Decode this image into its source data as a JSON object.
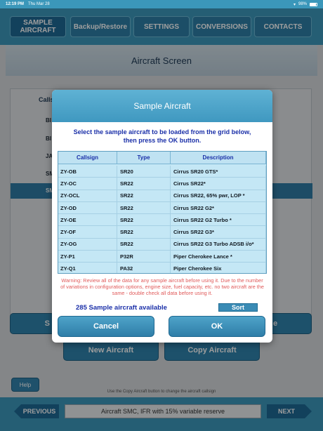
{
  "statusbar": {
    "time": "12:19 PM",
    "date": "Thu Mar 28",
    "battery": "98%"
  },
  "nav": [
    {
      "label": "SAMPLE AIRCRAFT"
    },
    {
      "label": "Backup/Restore"
    },
    {
      "label": "SETTINGS"
    },
    {
      "label": "CONVERSIONS"
    },
    {
      "label": "CONTACTS"
    }
  ],
  "screen": {
    "title": "Aircraft Screen"
  },
  "background_list": {
    "header": "Callsign",
    "rows": [
      "BI",
      "BI",
      "JA",
      "SM",
      "SM"
    ]
  },
  "background_buttons": {
    "new_aircraft": "New Aircraft",
    "copy_aircraft": "Copy Aircraft",
    "left_partial": "S",
    "right_partial": "e"
  },
  "footer": {
    "help": "Help",
    "hint": "Use the Copy Aircraft button to change the aircraft callsign",
    "previous": "PREVIOUS",
    "next": "NEXT",
    "status": "Aircraft SMC, IFR with 15% variable reserve"
  },
  "modal": {
    "title": "Sample Aircraft",
    "instruction_line1": "Select the sample aircraft to be loaded from the grid below,",
    "instruction_line2": "then press the OK button.",
    "columns": [
      "Callsign",
      "Type",
      "Description"
    ],
    "rows": [
      {
        "callsign": "ZY-OB",
        "type": "SR20",
        "description": "Cirrus SR20 GTS*"
      },
      {
        "callsign": "ZY-OC",
        "type": "SR22",
        "description": "Cirrus SR22*"
      },
      {
        "callsign": "ZY-OCL",
        "type": "SR22",
        "description": "Cirrus SR22, 65% pwr, LOP *"
      },
      {
        "callsign": "ZY-OD",
        "type": "SR22",
        "description": "Cirrus SR22 G2*"
      },
      {
        "callsign": "ZY-OE",
        "type": "SR22",
        "description": "Cirrus SR22 G2 Turbo *"
      },
      {
        "callsign": "ZY-OF",
        "type": "SR22",
        "description": "Cirrus SR22 G3*"
      },
      {
        "callsign": "ZY-OG",
        "type": "SR22",
        "description": "Cirrus SR22 G3 Turbo ADSB i/o*"
      },
      {
        "callsign": "ZY-P1",
        "type": "P32R",
        "description": "Piper Cherokee Lance *"
      },
      {
        "callsign": "ZY-Q1",
        "type": "PA32",
        "description": "Piper Cherokee Six"
      }
    ],
    "warning": "Warning: Review all of the data for any sample aircraft before using it. Due to the number of variations in configuration options, engine size, fuel capacity, etc. no two aircraft are the same - double check all data before using it.",
    "count_text": "285 Sample aircraft available",
    "sort_label": "Sort",
    "cancel_label": "Cancel",
    "ok_label": "OK"
  }
}
